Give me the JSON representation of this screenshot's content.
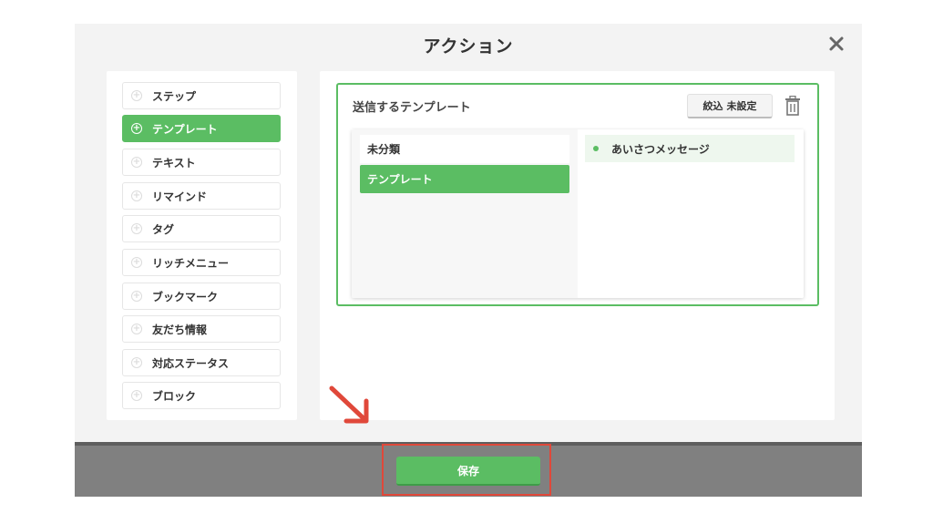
{
  "modal": {
    "title": "アクション",
    "close_icon": "close-icon"
  },
  "actions": {
    "items": [
      {
        "label": "ステップ",
        "active": false
      },
      {
        "label": "テンプレート",
        "active": true
      },
      {
        "label": "テキスト",
        "active": false
      },
      {
        "label": "リマインド",
        "active": false
      },
      {
        "label": "タグ",
        "active": false
      },
      {
        "label": "リッチメニュー",
        "active": false
      },
      {
        "label": "ブックマーク",
        "active": false
      },
      {
        "label": "友だち情報",
        "active": false
      },
      {
        "label": "対応ステータス",
        "active": false
      },
      {
        "label": "ブロック",
        "active": false
      }
    ]
  },
  "template": {
    "label": "送信するテンプレート",
    "filter_label": "絞込",
    "filter_value": "未設定",
    "folders": [
      {
        "label": "未分類",
        "active": false
      },
      {
        "label": "テンプレート",
        "active": true
      }
    ],
    "templates": [
      {
        "label": "あいさつメッセージ"
      }
    ]
  },
  "footer": {
    "save_label": "保存"
  },
  "colors": {
    "accent": "#5bbd63",
    "annotation": "#e0483a"
  }
}
